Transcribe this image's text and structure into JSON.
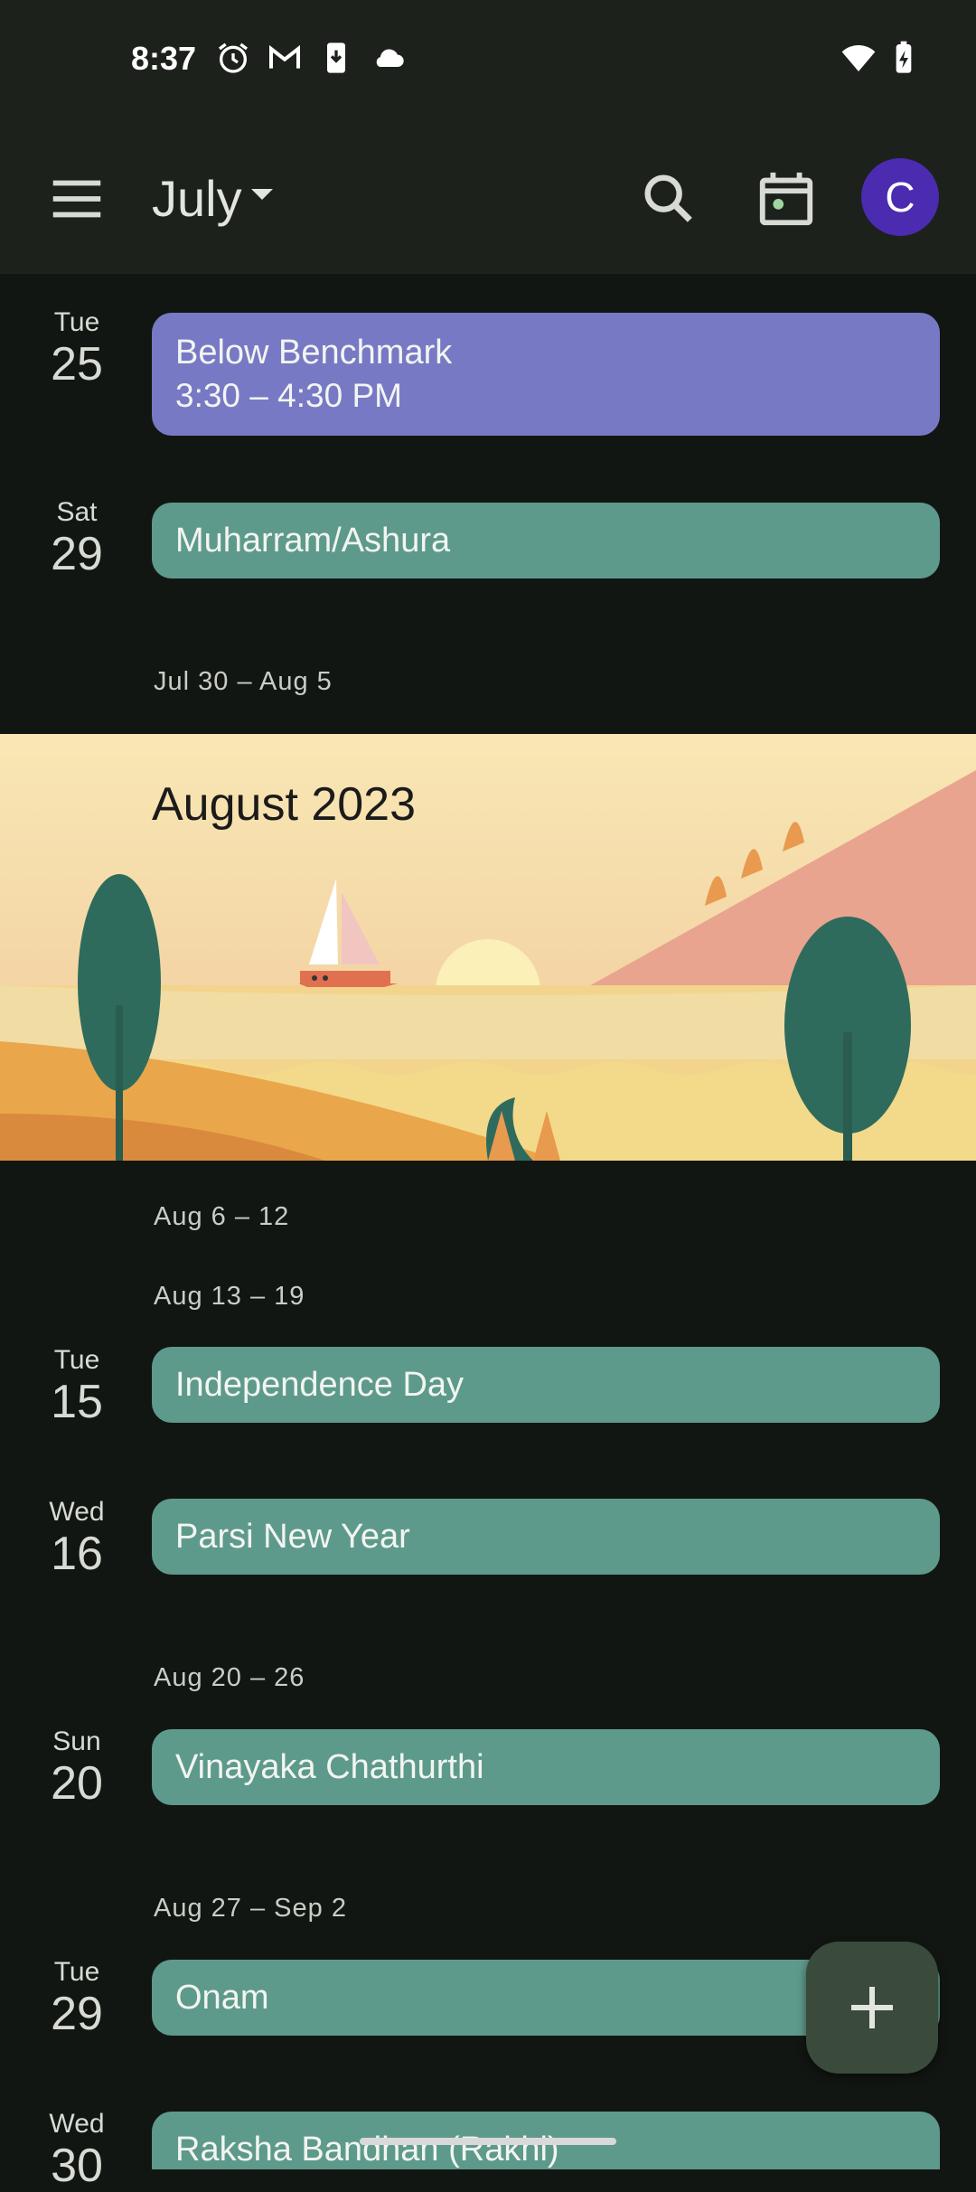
{
  "status_bar": {
    "time": "8:37"
  },
  "header": {
    "month": "July",
    "avatar_letter": "C"
  },
  "days": [
    {
      "dow": "Tue",
      "num": "25"
    },
    {
      "dow": "Sat",
      "num": "29"
    },
    {
      "dow": "Tue",
      "num": "15"
    },
    {
      "dow": "Wed",
      "num": "16"
    },
    {
      "dow": "Sun",
      "num": "20"
    },
    {
      "dow": "Tue",
      "num": "29"
    },
    {
      "dow": "Wed",
      "num": "30"
    }
  ],
  "events": [
    {
      "title": "Below Benchmark",
      "time": "3:30 – 4:30 PM"
    },
    {
      "title": "Muharram/Ashura"
    },
    {
      "title": "Independence Day"
    },
    {
      "title": "Parsi New Year"
    },
    {
      "title": "Vinayaka Chathurthi"
    },
    {
      "title": "Onam"
    },
    {
      "title": "Raksha Bandhan (Rakhi)"
    }
  ],
  "week_ranges": [
    "Jul 30 – Aug 5",
    "Aug 6 – 12",
    "Aug 13 – 19",
    "Aug 20 – 26",
    "Aug 27 – Sep 2"
  ],
  "banner": {
    "title": "August 2023"
  }
}
